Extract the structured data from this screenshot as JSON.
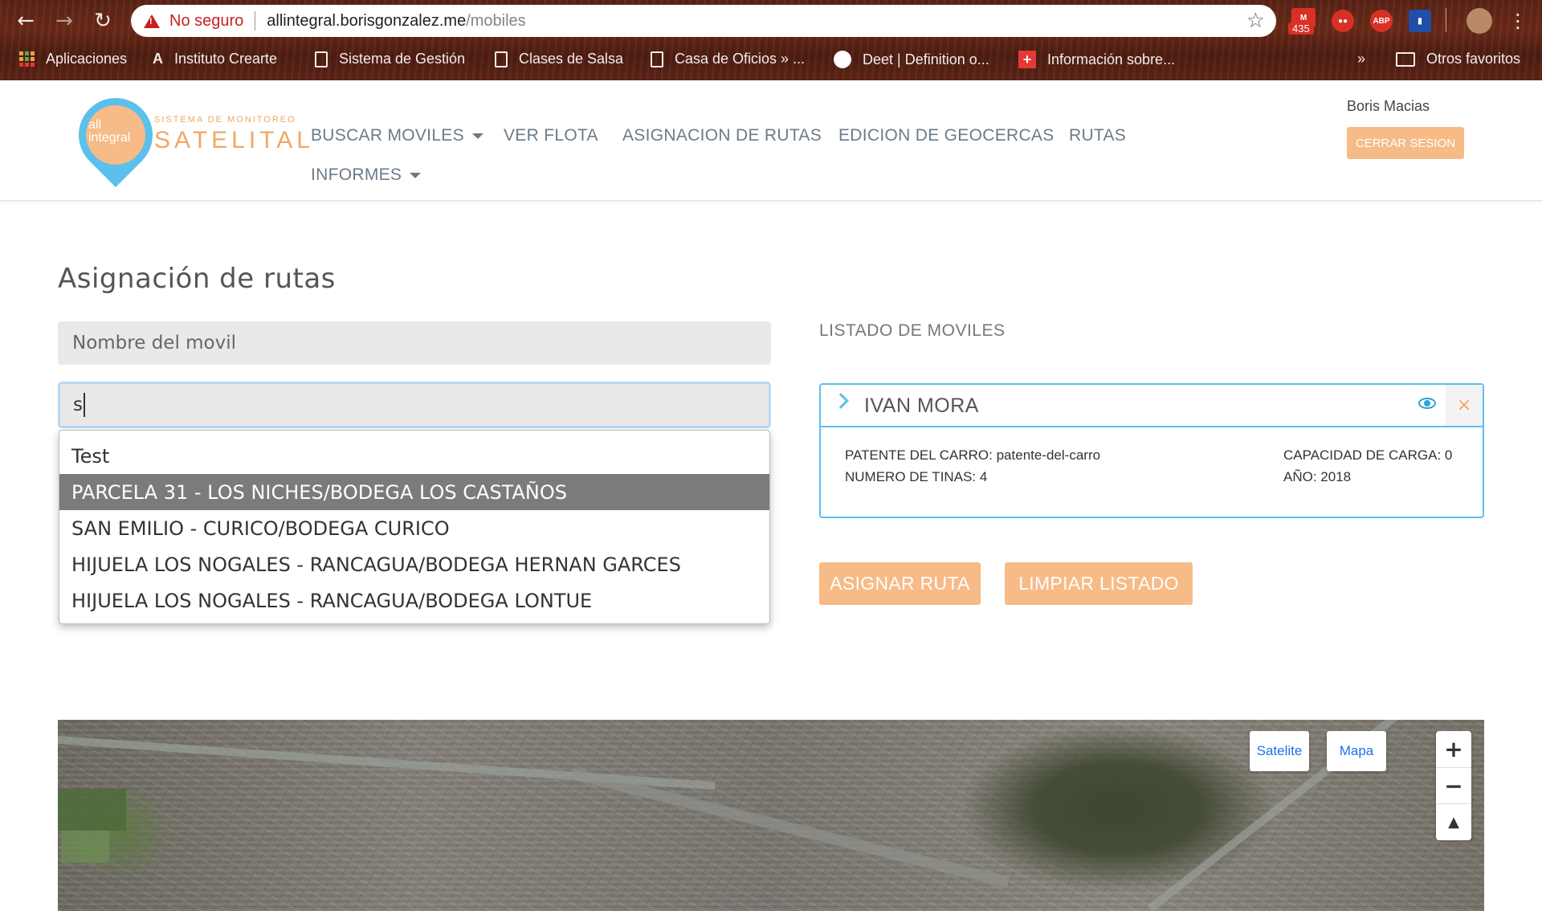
{
  "browser": {
    "security_label": "No seguro",
    "url_host": "allintegral.borisgonzalez.me",
    "url_path": "/mobiles",
    "gmail_count": "435",
    "ext_abp": "ABP",
    "bookmarks": [
      "Aplicaciones",
      "Instituto Crearte",
      "Sistema de Gestión",
      "Clases de Salsa",
      "Casa de Oficios » ...",
      "Deet | Definition o...",
      "Información sobre..."
    ],
    "more_bookmarks": "»",
    "other_bookmarks": "Otros favoritos"
  },
  "logo": {
    "inner_line1": "all",
    "inner_line2": "integral",
    "subtitle": "SISTEMA DE MONITOREO",
    "title": "SATELITAL"
  },
  "nav": {
    "buscar_moviles": "BUSCAR MOVILES",
    "ver_flota": "VER FLOTA",
    "asignacion_rutas": "ASIGNACION DE RUTAS",
    "edicion_geocercas": "EDICION DE GEOCERCAS",
    "rutas": "RUTAS",
    "informes": "INFORMES"
  },
  "user": {
    "name": "Boris Macias",
    "logout_label": "CERRAR SESION"
  },
  "page": {
    "title": "Asignación de rutas"
  },
  "form": {
    "movil_placeholder": "Nombre del movil",
    "route_value": "s"
  },
  "dropdown": {
    "items": [
      "Test",
      "PARCELA 31 - LOS NICHES/BODEGA LOS CASTAÑOS",
      "SAN EMILIO - CURICO/BODEGA CURICO",
      "HIJUELA LOS NOGALES - RANCAGUA/BODEGA HERNAN GARCES",
      "HIJUELA LOS NOGALES - RANCAGUA/BODEGA LONTUE"
    ],
    "active_index": 1
  },
  "list": {
    "title": "LISTADO DE MOVILES",
    "card": {
      "name": "IVAN MORA",
      "patente": "PATENTE DEL CARRO: patente-del-carro",
      "tinas": "NUMERO DE TINAS: 4",
      "capacidad": "CAPACIDAD DE CARGA: 0",
      "anio": "AÑO: 2018",
      "close_glyph": "×"
    }
  },
  "actions": {
    "assign": "ASIGNAR RUTA",
    "clear": "LIMPIAR LISTADO"
  },
  "map": {
    "satelite": "Satelite",
    "mapa": "Mapa",
    "zoom_in": "+",
    "zoom_out": "−",
    "compass": "▲"
  },
  "colors": {
    "accent_orange": "#f6bb86",
    "accent_blue": "#5bc0eb",
    "warning_red": "#c5221f"
  }
}
